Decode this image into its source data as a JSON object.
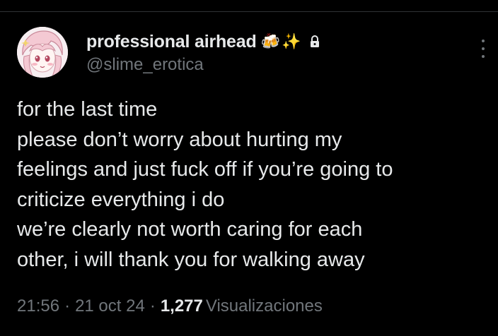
{
  "tweet": {
    "author": {
      "display_name": "professional airhead",
      "badges": [
        "beer-mugs-emoji",
        "sparkles-emoji",
        "lock-icon"
      ],
      "handle": "@slime_erotica"
    },
    "text_lines": [
      "for the last time",
      "please don’t worry about hurting my",
      "feelings and just fuck off if you’re going to",
      "criticize everything i do",
      "we’re clearly not worth caring for each",
      "other, i will thank you for walking away"
    ],
    "time": "21:56",
    "separator": "·",
    "date": "21 oct 24",
    "views_count": "1,277",
    "views_label": "Visualizaciones"
  },
  "colors": {
    "background": "#000000",
    "text_primary": "#e7e9ea",
    "text_secondary": "#71767b",
    "divider": "#2f3336"
  }
}
